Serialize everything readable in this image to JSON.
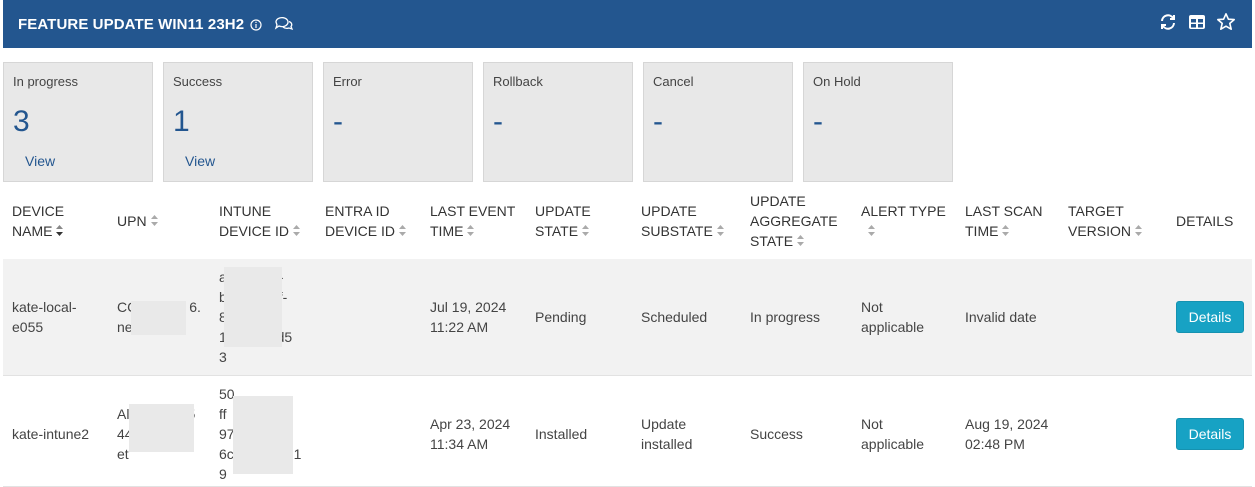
{
  "header": {
    "title": "FEATURE UPDATE WIN11 23H2",
    "icons": [
      "info-icon",
      "chat-icon",
      "refresh-icon",
      "columns-icon",
      "star-icon"
    ],
    "bg_color": "#23568f"
  },
  "cards": [
    {
      "label": "In progress",
      "count": "3",
      "view": "View"
    },
    {
      "label": "Success",
      "count": "1",
      "view": "View"
    },
    {
      "label": "Error",
      "count": "-",
      "view": ""
    },
    {
      "label": "Rollback",
      "count": "-",
      "view": ""
    },
    {
      "label": "Cancel",
      "count": "-",
      "view": ""
    },
    {
      "label": "On Hold",
      "count": "-",
      "view": ""
    }
  ],
  "columns": {
    "device_name_1": "DEVICE",
    "device_name_2": "NAME",
    "upn": "UPN",
    "intune_1": "INTUNE",
    "intune_2": "DEVICE ID",
    "entra_1": "ENTRA ID",
    "entra_2": "DEVICE ID",
    "last_event_1": "LAST EVENT",
    "last_event_2": "TIME",
    "update_state_1": "UPDATE",
    "update_state_2": "STATE",
    "update_substate_1": "UPDATE",
    "update_substate_2": "SUBSTATE",
    "aggregate_1": "UPDATE",
    "aggregate_2": "AGGREGATE",
    "aggregate_3": "STATE",
    "alert_type": "ALERT TYPE",
    "last_scan_1": "LAST SCAN",
    "last_scan_2": "TIME",
    "target_1": "TARGET",
    "target_2": "VERSION",
    "details": "DETAILS"
  },
  "rows": [
    {
      "device_1": "kate-local-",
      "device_2": "e055",
      "upn_1": "CC",
      "upn_1b": "6.",
      "upn_2": "ne",
      "intune_1": "a",
      "intune_1b": "-",
      "intune_2": "b",
      "intune_2b": "f-",
      "intune_3": "8",
      "intune_4": "1",
      "intune_4b": "7d5",
      "intune_5": "3",
      "event_1": "Jul 19, 2024",
      "event_2": "11:22 AM",
      "state": "Pending",
      "substate_1": "Scheduled",
      "substate_2": "",
      "aggregate": "In progress",
      "alert_1": "Not",
      "alert_2": "applicable",
      "scan_1": "Invalid date",
      "scan_2": "",
      "details": "Details"
    },
    {
      "device_1": "kate-intune2",
      "device_2": "",
      "upn_1": "Al",
      "upn_1b": "5",
      "upn_2": "44",
      "upn_2b": "n",
      "upn_3": "et",
      "intune_1": "50",
      "intune_2": "ff",
      "intune_3": "97",
      "intune_4": "6c",
      "intune_4b": "51",
      "intune_5": "9",
      "event_1": "Apr 23, 2024",
      "event_2": "11:34 AM",
      "state": "Installed",
      "substate_1": "Update",
      "substate_2": "installed",
      "aggregate": "Success",
      "alert_1": "Not",
      "alert_2": "applicable",
      "scan_1": "Aug 19, 2024",
      "scan_2": "02:48 PM",
      "details": "Details"
    }
  ]
}
